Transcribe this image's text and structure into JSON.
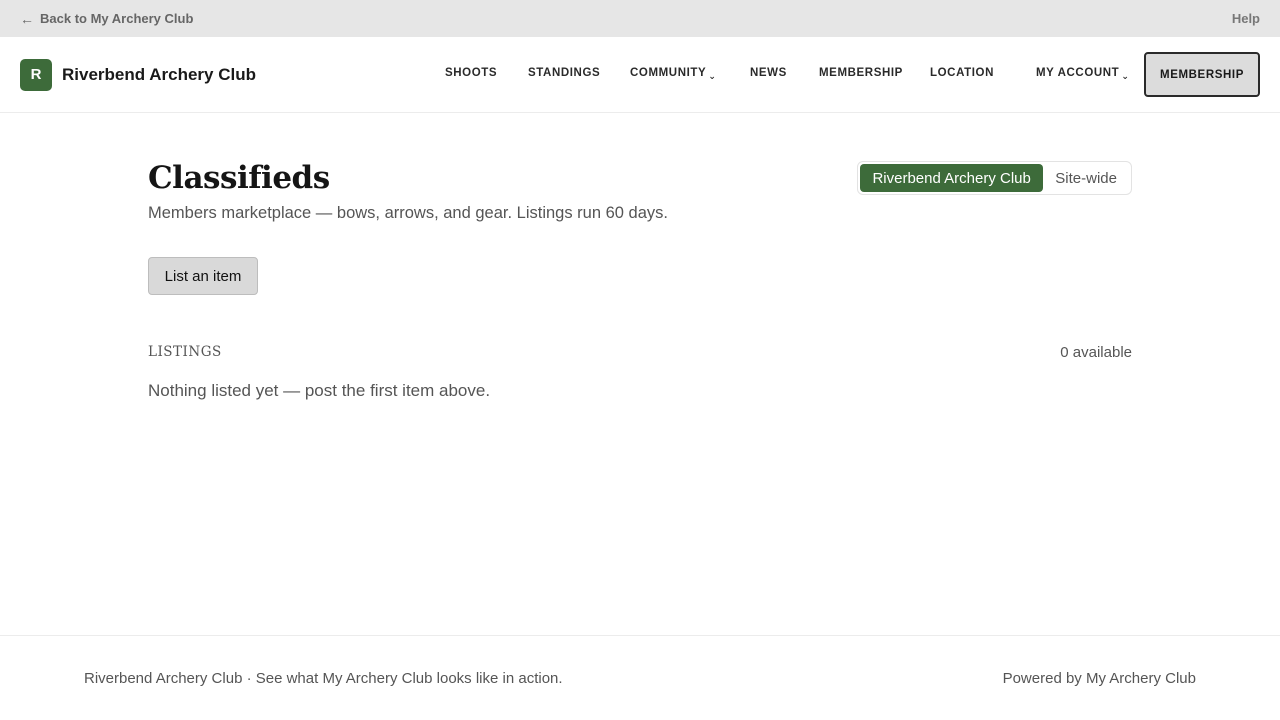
{
  "topbar": {
    "back_arrow": "←",
    "back_label": "Back to My Archery Club",
    "help_label": "Help"
  },
  "brand": {
    "logo_letter": "R",
    "name": "Riverbend Archery Club",
    "color": "#3d6b3a"
  },
  "nav": {
    "items": [
      {
        "label": "SHOOTS"
      },
      {
        "label": "STANDINGS"
      },
      {
        "label": "COMMUNITY",
        "caret": "⌄"
      },
      {
        "label": "NEWS"
      },
      {
        "label": "MEMBERSHIP"
      },
      {
        "label": "LOCATION"
      },
      {
        "label": "MY ACCOUNT",
        "caret": "⌄"
      }
    ],
    "cta_label": "MEMBERSHIP"
  },
  "page": {
    "title": "Classifieds",
    "subtitle": "Members marketplace — bows, arrows, and gear. Listings run 60 days."
  },
  "scope_toggle": {
    "options": [
      {
        "label": "Riverbend Archery Club",
        "active": true
      },
      {
        "label": "Site-wide",
        "active": false
      }
    ]
  },
  "actions": {
    "list_item_label": "List an item"
  },
  "listings": {
    "section_label": "LISTINGS",
    "count_label": "0 available",
    "empty_message": "Nothing listed yet — post the first item above."
  },
  "footer": {
    "left_text": "Riverbend Archery Club · See what My Archery Club looks like in action.",
    "right_text": "Powered by My Archery Club"
  }
}
